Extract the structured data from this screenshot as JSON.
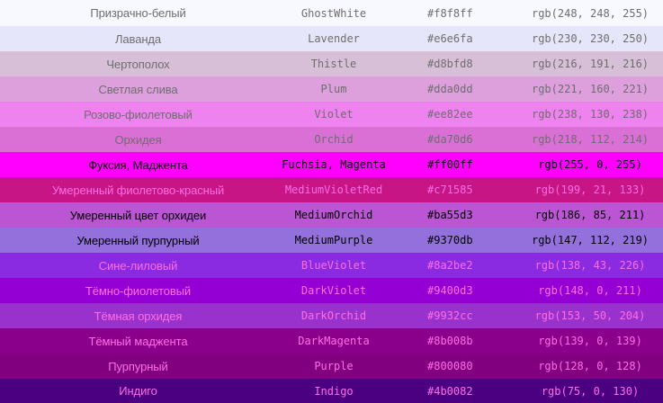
{
  "colors": [
    {
      "ru": "Призрачно-белый",
      "en": "GhostWhite",
      "hex": "#f8f8ff",
      "rgb": "rgb(248, 248, 255)",
      "bg": "#f8f8ff",
      "fg": "#6e6e6e"
    },
    {
      "ru": "Лаванда",
      "en": "Lavender",
      "hex": "#e6e6fa",
      "rgb": "rgb(230, 230, 250)",
      "bg": "#e6e6fa",
      "fg": "#6e6e6e"
    },
    {
      "ru": "Чертополох",
      "en": "Thistle",
      "hex": "#d8bfd8",
      "rgb": "rgb(216, 191, 216)",
      "bg": "#d8bfd8",
      "fg": "#6e6e6e"
    },
    {
      "ru": "Светлая слива",
      "en": "Plum",
      "hex": "#dda0dd",
      "rgb": "rgb(221, 160, 221)",
      "bg": "#dda0dd",
      "fg": "#6e6e6e"
    },
    {
      "ru": "Розово-фиолетовый",
      "en": "Violet",
      "hex": "#ee82ee",
      "rgb": "rgb(238, 130, 238)",
      "bg": "#ee82ee",
      "fg": "#6e6e6e"
    },
    {
      "ru": "Орхидея",
      "en": "Orchid",
      "hex": "#da70d6",
      "rgb": "rgb(218, 112, 214)",
      "bg": "#da70d6",
      "fg": "#6e6e6e"
    },
    {
      "ru": "Фуксия, Маджента",
      "en": "Fuchsia, Magenta",
      "hex": "#ff00ff",
      "rgb": "rgb(255, 0, 255)",
      "bg": "#ff00ff",
      "fg": "#000000"
    },
    {
      "ru": "Умеренный фиолетово-красный",
      "en": "MediumVioletRed",
      "hex": "#c71585",
      "rgb": "rgb(199, 21, 133)",
      "bg": "#c71585",
      "fg": "#ff6ee6"
    },
    {
      "ru": "Умеренный цвет орхидеи",
      "en": "MediumOrchid",
      "hex": "#ba55d3",
      "rgb": "rgb(186, 85, 211)",
      "bg": "#ba55d3",
      "fg": "#000000"
    },
    {
      "ru": "Умеренный пурпурный",
      "en": "MediumPurple",
      "hex": "#9370db",
      "rgb": "rgb(147, 112, 219)",
      "bg": "#9370db",
      "fg": "#000000"
    },
    {
      "ru": "Сине-лиловый",
      "en": "BlueViolet",
      "hex": "#8a2be2",
      "rgb": "rgb(138, 43, 226)",
      "bg": "#8a2be2",
      "fg": "#ff6ee6"
    },
    {
      "ru": "Тёмно-фиолетовый",
      "en": "DarkViolet",
      "hex": "#9400d3",
      "rgb": "rgb(148, 0, 211)",
      "bg": "#9400d3",
      "fg": "#ff6ee6"
    },
    {
      "ru": "Тёмная орхидея",
      "en": "DarkOrchid",
      "hex": "#9932cc",
      "rgb": "rgb(153, 50, 204)",
      "bg": "#9932cc",
      "fg": "#ff6ee6"
    },
    {
      "ru": "Тёмный маджента",
      "en": "DarkMagenta",
      "hex": "#8b008b",
      "rgb": "rgb(139, 0, 139)",
      "bg": "#8b008b",
      "fg": "#ff6ee6"
    },
    {
      "ru": "Пурпурный",
      "en": "Purple",
      "hex": "#800080",
      "rgb": "rgb(128, 0, 128)",
      "bg": "#800080",
      "fg": "#ff6ee6"
    },
    {
      "ru": "Индиго",
      "en": "Indigo",
      "hex": "#4b0082",
      "rgb": "rgb(75, 0, 130)",
      "bg": "#4b0082",
      "fg": "#ff6ee6"
    }
  ]
}
